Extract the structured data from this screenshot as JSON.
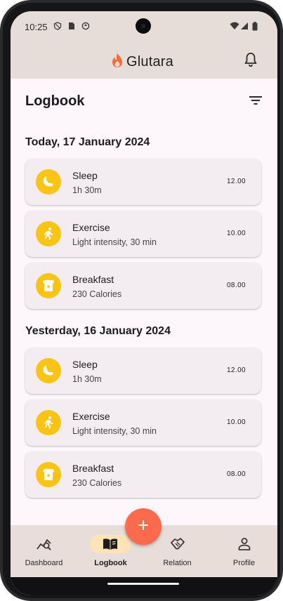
{
  "status_bar": {
    "time": "10:25",
    "left_icons": [
      "shield-icon",
      "sim-card-icon",
      "data-saver-icon"
    ],
    "right_icons": [
      "wifi-icon",
      "signal-icon",
      "battery-icon"
    ]
  },
  "app_bar": {
    "brand_name": "Glutara",
    "logo_icon": "flame-logo-icon",
    "notification_icon": "bell-icon"
  },
  "page": {
    "title": "Logbook",
    "filter_icon": "filter-icon"
  },
  "sections": [
    {
      "date": "Today, 17 January 2024",
      "entries": [
        {
          "title": "Sleep",
          "detail": "1h 30m",
          "time": "12.00",
          "icon": "moon-icon"
        },
        {
          "title": "Exercise",
          "detail": "Light intensity, 30 min",
          "time": "10.00",
          "icon": "run-icon"
        },
        {
          "title": "Breakfast",
          "detail": "230 Calories",
          "time": "08.00",
          "icon": "bread-icon"
        }
      ]
    },
    {
      "date": "Yesterday, 16 January 2024",
      "entries": [
        {
          "title": "Sleep",
          "detail": "1h 30m",
          "time": "12.00",
          "icon": "moon-icon"
        },
        {
          "title": "Exercise",
          "detail": "Light intensity, 30 min",
          "time": "10.00",
          "icon": "run-icon"
        },
        {
          "title": "Breakfast",
          "detail": "230 Calories",
          "time": "08.00",
          "icon": "bread-icon"
        }
      ]
    }
  ],
  "fab": {
    "icon": "plus-icon"
  },
  "bottom_nav": {
    "active": "Logbook",
    "items": [
      {
        "label": "Dashboard",
        "icon": "chart-search-icon"
      },
      {
        "label": "Logbook",
        "icon": "book-icon"
      },
      {
        "label": "Relation",
        "icon": "handshake-icon"
      },
      {
        "label": "Profile",
        "icon": "person-icon"
      }
    ]
  },
  "colors": {
    "accent_yellow": "#fbc414",
    "fab_orange": "#fe6a4c",
    "header_bg": "#e6ddd9",
    "card_bg": "#f3edf1",
    "active_nav_pill": "#fde3b6"
  }
}
